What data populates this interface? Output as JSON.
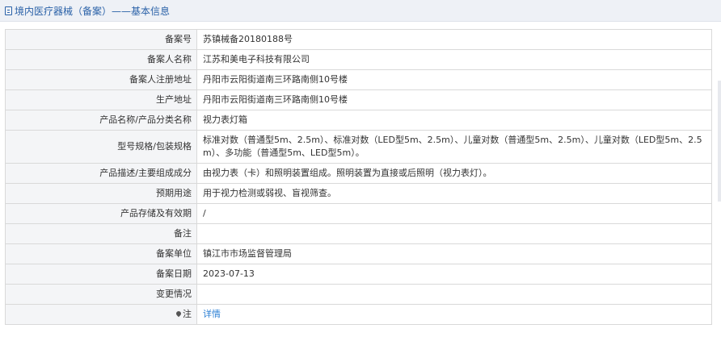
{
  "header": {
    "title": "境内医疗器械（备案）",
    "subtitle": "——基本信息"
  },
  "rows": [
    {
      "label": "备案号",
      "value": "苏镇械备20180188号"
    },
    {
      "label": "备案人名称",
      "value": "江苏和美电子科技有限公司"
    },
    {
      "label": "备案人注册地址",
      "value": "丹阳市云阳街道南三环路南侧10号楼"
    },
    {
      "label": "生产地址",
      "value": "丹阳市云阳街道南三环路南侧10号楼"
    },
    {
      "label": "产品名称/产品分类名称",
      "value": "视力表灯箱"
    },
    {
      "label": "型号规格/包装规格",
      "value": "标准对数（普通型5m、2.5m）、标准对数（LED型5m、2.5m）、儿童对数（普通型5m、2.5m）、儿童对数（LED型5m、2.5m）、多功能（普通型5m、LED型5m）。"
    },
    {
      "label": "产品描述/主要组成成分",
      "value": "由视力表（卡）和照明装置组成。照明装置为直接或后照明（视力表灯）。"
    },
    {
      "label": "预期用途",
      "value": "用于视力检测或弱视、盲视筛查。"
    },
    {
      "label": "产品存储及有效期",
      "value": "/"
    },
    {
      "label": "备注",
      "value": ""
    },
    {
      "label": "备案单位",
      "value": "镇江市市场监督管理局"
    },
    {
      "label": "备案日期",
      "value": "2023-07-13"
    },
    {
      "label": "变更情况",
      "value": ""
    },
    {
      "label": "注",
      "value": "详情"
    }
  ],
  "colors": {
    "header_bg": "#eef1f6",
    "header_text": "#2b62a8",
    "label_bg": "#f4f5f7",
    "link": "#2b7fd4"
  },
  "icons": {
    "header": "document-icon",
    "note": "pin-icon"
  }
}
